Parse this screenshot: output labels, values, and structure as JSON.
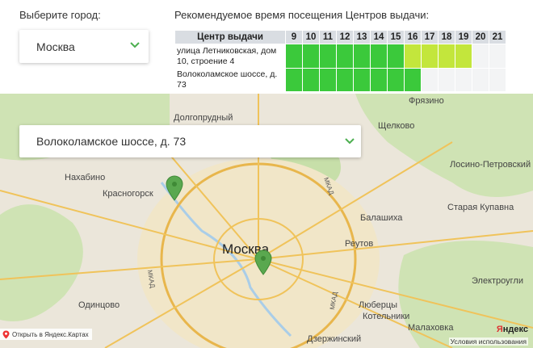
{
  "city": {
    "label": "Выберите город:",
    "selected": "Москва"
  },
  "schedule": {
    "title": "Рекомендуемое время посещения Центров выдачи:",
    "name_header": "Центр выдачи",
    "hours": [
      "9",
      "10",
      "11",
      "12",
      "13",
      "14",
      "15",
      "16",
      "17",
      "18",
      "19",
      "20",
      "21"
    ],
    "rows": [
      {
        "name": "улица Летниковская, дом 10, строение 4",
        "levels": [
          "green",
          "green",
          "green",
          "green",
          "green",
          "green",
          "green",
          "lime",
          "lime",
          "lime",
          "lime",
          "empty",
          "empty"
        ]
      },
      {
        "name": "Волоколамское шоссе, д. 73",
        "levels": [
          "green",
          "green",
          "green",
          "green",
          "green",
          "green",
          "green",
          "green",
          "empty",
          "empty",
          "empty",
          "empty",
          "empty"
        ]
      }
    ],
    "colors": {
      "green": "#3bc93b",
      "lime": "#c3e63c",
      "empty": "#f3f4f5"
    }
  },
  "map": {
    "selected_point": "Волоколамское шоссе, д. 73",
    "labels": {
      "moscow": "Москва",
      "frazino": "Фрязино",
      "dolgoprudny": "Долгопрудный",
      "schelkovo": "Щелково",
      "zelenograd_area": "Нахабино",
      "krasnogorsk": "Красногорск",
      "balashikha": "Балашиха",
      "reutov": "Реутов",
      "losino": "Лосино-Петровский",
      "kupavna": "Старая Купавна",
      "odintsovo": "Одинцово",
      "lyubertsy": "Люберцы",
      "kotelniki": "Котельники",
      "dzerzhinsky": "Дзержинский",
      "malakhovka": "Малаховка",
      "elektrougli": "Электроугли",
      "mkad1": "МКАД",
      "mkad2": "МКАД",
      "mkad3": "МКАД"
    },
    "open_link": "Открыть в Яндекс.Картах",
    "logo_red": "Я",
    "logo_black": "ндекс",
    "terms": "Условия использования"
  }
}
